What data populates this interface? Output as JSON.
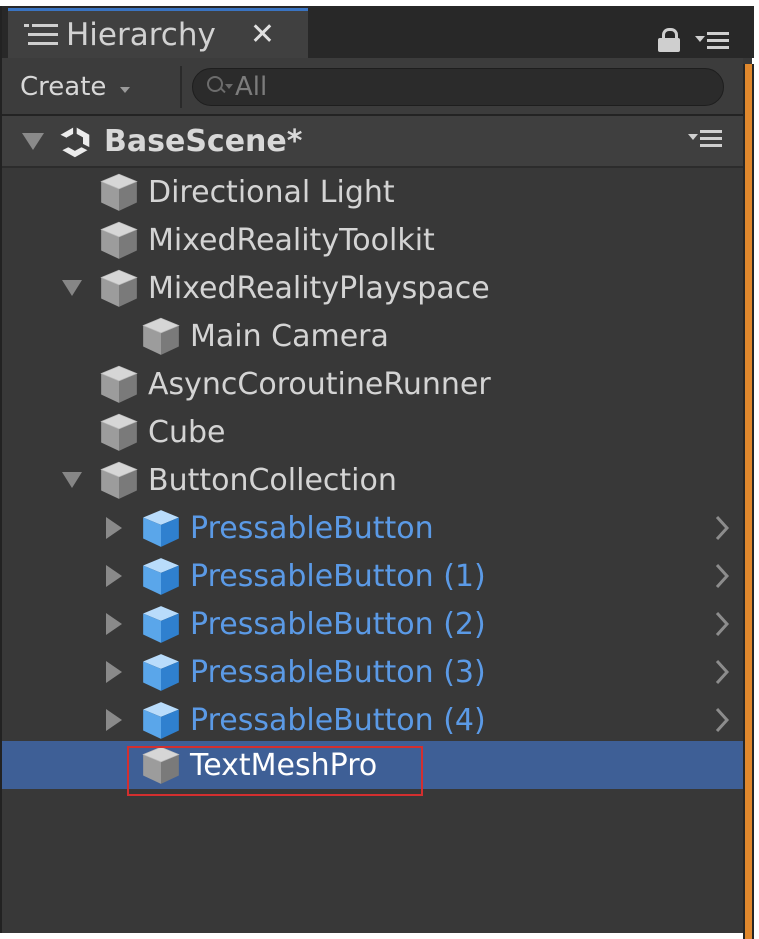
{
  "tab": {
    "title": "Hierarchy",
    "close_glyph": "✕"
  },
  "toolbar": {
    "create_label": "Create",
    "search_placeholder": "All"
  },
  "scene": {
    "name": "BaseScene*"
  },
  "items": [
    {
      "label": "Directional Light",
      "icon": "gameobject-cube-icon",
      "prefab": false
    },
    {
      "label": "MixedRealityToolkit",
      "icon": "gameobject-cube-icon",
      "prefab": false
    },
    {
      "label": "MixedRealityPlayspace",
      "icon": "gameobject-cube-icon",
      "prefab": false,
      "expanded": true
    },
    {
      "label": "Main Camera",
      "icon": "gameobject-cube-icon",
      "prefab": false
    },
    {
      "label": "AsyncCoroutineRunner",
      "icon": "gameobject-cube-icon",
      "prefab": false
    },
    {
      "label": "Cube",
      "icon": "gameobject-cube-icon",
      "prefab": false
    },
    {
      "label": "ButtonCollection",
      "icon": "gameobject-cube-icon",
      "prefab": false,
      "expanded": true
    },
    {
      "label": "PressableButton",
      "icon": "prefab-cube-icon",
      "prefab": true,
      "expanded": false
    },
    {
      "label": "PressableButton (1)",
      "icon": "prefab-cube-icon",
      "prefab": true,
      "expanded": false
    },
    {
      "label": "PressableButton (2)",
      "icon": "prefab-cube-icon",
      "prefab": true,
      "expanded": false
    },
    {
      "label": "PressableButton (3)",
      "icon": "prefab-cube-icon",
      "prefab": true,
      "expanded": false
    },
    {
      "label": "PressableButton (4)",
      "icon": "prefab-cube-icon",
      "prefab": true,
      "expanded": false
    },
    {
      "label": "TextMeshPro",
      "icon": "gameobject-cube-icon",
      "prefab": false,
      "selected": true
    }
  ],
  "colors": {
    "selection": "#3e5f96",
    "prefab_text": "#5b9ae6",
    "highlight_border": "#d32f2f",
    "dock_edge": "#e0882d"
  }
}
